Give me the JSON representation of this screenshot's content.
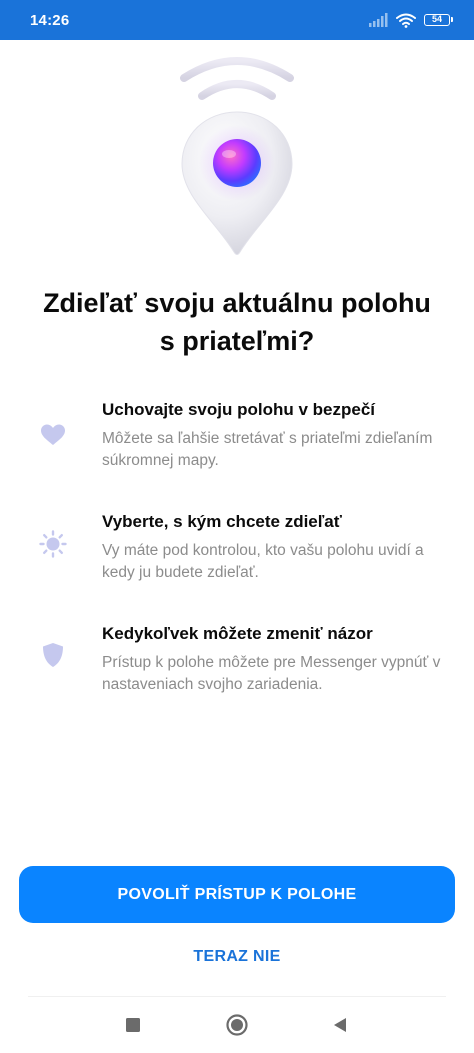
{
  "status_bar": {
    "time": "14:26",
    "battery_level": "54",
    "icons": [
      "signal-icon",
      "wifi-icon",
      "battery-icon"
    ]
  },
  "hero": {
    "icon": "location-pin-broadcast-icon"
  },
  "title": "Zdieľať svoju aktuálnu polohu s priateľmi?",
  "features": [
    {
      "icon": "heart-icon",
      "title": "Uchovajte svoju polohu v bezpečí",
      "description": "Môžete sa ľahšie stretávať s priateľmi zdieľaním súkromnej mapy."
    },
    {
      "icon": "sun-icon",
      "title": "Vyberte, s kým chcete zdieľať",
      "description": "Vy máte pod kontrolou, kto vašu polohu uvidí a kedy ju budete zdieľať."
    },
    {
      "icon": "shield-icon",
      "title": "Kedykoľvek môžete zmeniť názor",
      "description": "Prístup k polohe môžete pre Messenger vypnúť v nastaveniach svojho zariadenia."
    }
  ],
  "actions": {
    "allow_label": "POVOLIŤ PRÍSTUP K POLOHE",
    "deny_label": "TERAZ NIE"
  },
  "colors": {
    "status_bar": "#1a73d9",
    "primary_button": "#0a84ff",
    "link": "#1a73d9",
    "feature_icon": "#c5c8ee"
  },
  "nav_bar": {
    "buttons": [
      "recent-apps-icon",
      "home-icon",
      "back-icon"
    ]
  }
}
